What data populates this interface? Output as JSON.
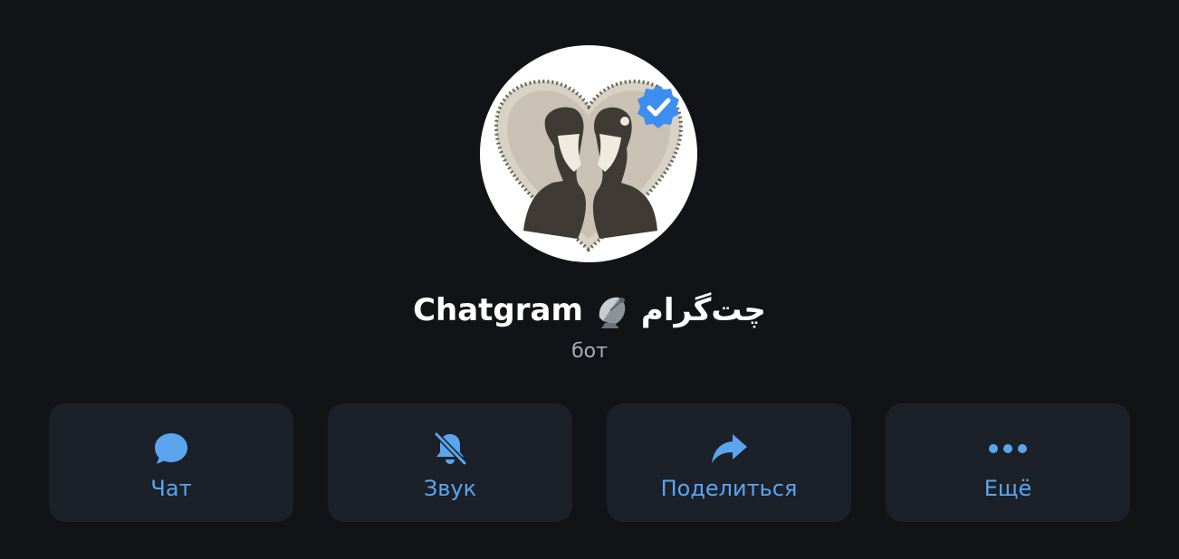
{
  "profile": {
    "name_latin": "Chatgram",
    "name_emoji": "satellite-dish-icon",
    "name_persian": "چت‌گرام",
    "subtitle": "бот",
    "verified": true
  },
  "colors": {
    "background": "#121316",
    "card": "#1b2029",
    "accent": "#5aa5ee",
    "verified_badge": "#3d8ef0",
    "subtitle": "#a7abb3"
  },
  "actions": [
    {
      "label": "Чат",
      "icon": "chat-bubble-icon"
    },
    {
      "label": "Звук",
      "icon": "bell-muted-icon"
    },
    {
      "label": "Поделиться",
      "icon": "share-arrow-icon"
    },
    {
      "label": "Ещё",
      "icon": "more-dots-icon"
    }
  ]
}
